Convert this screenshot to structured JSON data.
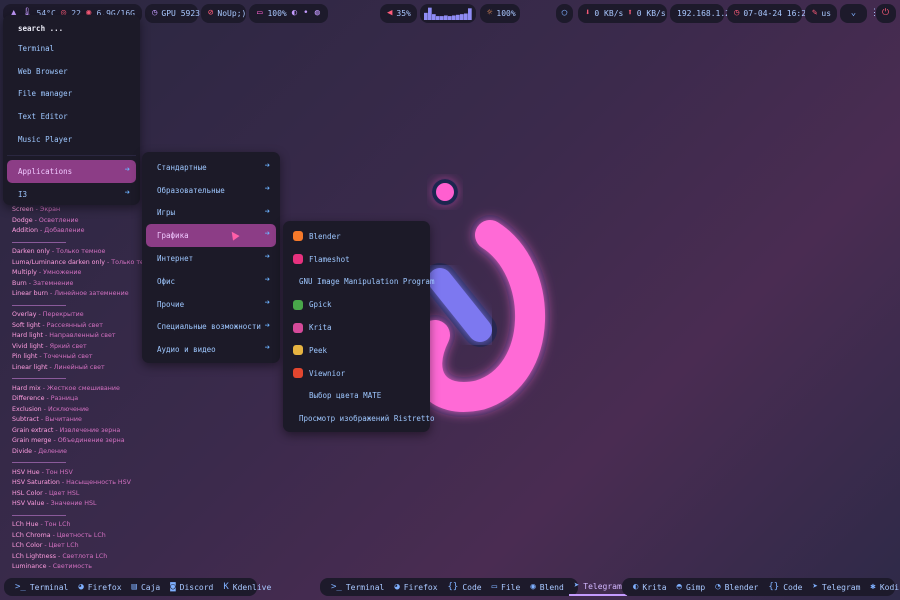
{
  "top_bar": {
    "cpu_temp": "54°C",
    "cpu_load": "22",
    "mem": "6.9G/16G",
    "gpu": "GPU 5923",
    "updates": "NoUp;)",
    "battery": "100%",
    "volume": "35%",
    "brightness": "100%",
    "net_down": "0 KB/s",
    "net_up": "0 KB/s",
    "ip": "192.168.1.2",
    "datetime": "07-04-24 16:20",
    "layout": "us",
    "cpu_graph_levels": [
      0.55,
      0.95,
      0.45,
      0.3,
      0.3,
      0.35,
      0.3,
      0.35,
      0.4,
      0.45,
      0.5,
      0.9
    ]
  },
  "launcher": {
    "search": "search ...",
    "items": [
      "Terminal",
      "Web Browser",
      "File manager",
      "Text Editor",
      "Music Player"
    ],
    "applications": "Applications",
    "i3": "I3"
  },
  "categories": [
    "Стандартные",
    "Образовательные",
    "Игры",
    "Графика",
    "Интернет",
    "Офис",
    "Прочие",
    "Специальные возможности",
    "Аудио и видео"
  ],
  "graphics_apps": [
    {
      "label": "Blender",
      "color": "#f5792a"
    },
    {
      "label": "Flameshot",
      "color": "#e6317e"
    },
    {
      "label": "GNU Image Manipulation Program",
      "color": "#8a8a78"
    },
    {
      "label": "Gpick",
      "color": "#49a64a"
    },
    {
      "label": "Krita",
      "color": "#d54a9a"
    },
    {
      "label": "Peek",
      "color": "#e6b341"
    },
    {
      "label": "Viewnior",
      "color": "#e2462f"
    },
    {
      "label": "Выбор цвета MATE",
      "color": ""
    },
    {
      "label": "Просмотр изображений Ristretto",
      "color": "#e0c54a"
    }
  ],
  "blend_list": [
    [
      "Screen",
      " - Экран"
    ],
    [
      "Dodge",
      " - Осветление"
    ],
    [
      "Addition",
      " - Добавление"
    ],
    null,
    [
      "Darken only",
      " - Только темное"
    ],
    [
      "Luma/Luminance darken only",
      " - Только темное"
    ],
    [
      "Multiply",
      " - Умножение"
    ],
    [
      "Burn",
      " - Затемнение"
    ],
    [
      "Linear burn",
      " - Линейное затемнение"
    ],
    null,
    [
      "Overlay",
      " - Перекрытие"
    ],
    [
      "Soft light",
      " - Рассеянный свет"
    ],
    [
      "Hard light",
      " - Направленный свет"
    ],
    [
      "Vivid light",
      " - Яркий свет"
    ],
    [
      "Pin light",
      " - Точечный свет"
    ],
    [
      "Linear light",
      " - Линейный свет"
    ],
    null,
    [
      "Hard mix",
      " - Жесткое смешивание"
    ],
    [
      "Difference",
      " - Разница"
    ],
    [
      "Exclusion",
      " - Исключение"
    ],
    [
      "Subtract",
      " - Вычитание"
    ],
    [
      "Grain extract",
      " - Извлечение зерна"
    ],
    [
      "Grain merge",
      " - Объединение зерна"
    ],
    [
      "Divide",
      " - Деление"
    ],
    null,
    [
      "HSV Hue",
      " - Тон HSV"
    ],
    [
      "HSV Saturation",
      " - Насыщенность HSV"
    ],
    [
      "HSL Color",
      " - Цвет HSL"
    ],
    [
      "HSV Value",
      " - Значение HSL"
    ],
    null,
    [
      "LCh Hue",
      " - Тон LCh"
    ],
    [
      "LCh Chroma",
      " - Цветность LCh"
    ],
    [
      "LCh Color",
      " - Цвет LCh"
    ],
    [
      "LCh Lightness",
      " - Светлота LCh"
    ],
    [
      "Luminance",
      " - Светимость"
    ]
  ],
  "taskbar_left": [
    "Terminal",
    "Firefox",
    "Caja",
    "Discord",
    "Kdenlive"
  ],
  "taskbar_center": [
    "Terminal",
    "Firefox",
    "Code",
    "File",
    "Blend",
    "Telegram"
  ],
  "taskbar_right": [
    "Krita",
    "Gimp",
    "Blender",
    "Code",
    "Telegram",
    "Kodi"
  ],
  "colors": {
    "bar_bg": "#1d1a2b",
    "menu_bg": "#1c1a28",
    "active": "#8c3d86",
    "text": "#9ec7ff",
    "accent_pink": "#ff5fd0"
  }
}
